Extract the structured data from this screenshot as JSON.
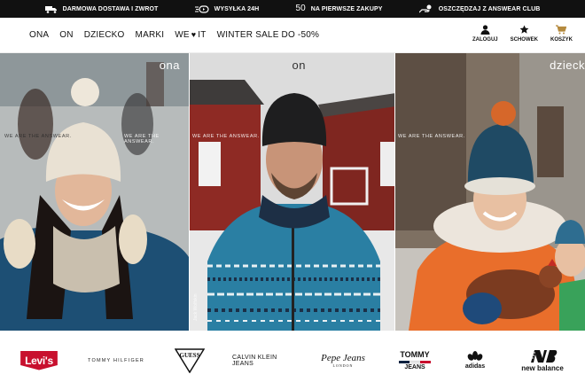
{
  "promo_bar": {
    "items": [
      {
        "icon": "truck-icon",
        "label": "DARMOWA DOSTAWA I ZWROT"
      },
      {
        "icon": "fast-delivery-icon",
        "label": "WYSYŁKA 24H"
      },
      {
        "icon": "fifty-badge-icon",
        "badge_text": "50",
        "label": "NA PIERWSZE ZAKUPY"
      },
      {
        "icon": "hand-coin-icon",
        "label": "OSZCZĘDZAJ Z ANSWEAR CLUB"
      }
    ]
  },
  "nav": {
    "items": [
      "ONA",
      "ON",
      "DZIECKO",
      "MARKI"
    ],
    "we_love_it": {
      "before": "WE",
      "after": "IT"
    },
    "sale": "WINTER SALE DO -50%"
  },
  "actions": {
    "login": "ZALOGUJ",
    "wishlist": "SCHOWEK",
    "cart": "KOSZYK"
  },
  "hero": {
    "panels": [
      {
        "label": "ona",
        "tagline": "WE ARE THE ANSWEAR."
      },
      {
        "label": "on",
        "tagline": "WE ARE THE ANSWEAR."
      },
      {
        "label": "dzieck",
        "tagline": "WE ARE THE ANSWEAR."
      }
    ],
    "credit": "Jack Wolfskin"
  },
  "brands": {
    "levis": "Levi's",
    "tommy_hilfiger": "TOMMY HILFIGER",
    "guess": "GUESS",
    "calvin_klein": "CALVIN KLEIN JEANS",
    "pepe_jeans": "Pepe Jeans",
    "pepe_sub": "LONDON",
    "tommy_jeans_top": "TOMMY",
    "tommy_jeans_bottom": "JEANS",
    "adidas": "adidas",
    "new_balance": "new balance"
  },
  "colors": {
    "promo_bg": "#111111",
    "cart_accent": "#b58a3e",
    "levis_red": "#c8102e"
  }
}
